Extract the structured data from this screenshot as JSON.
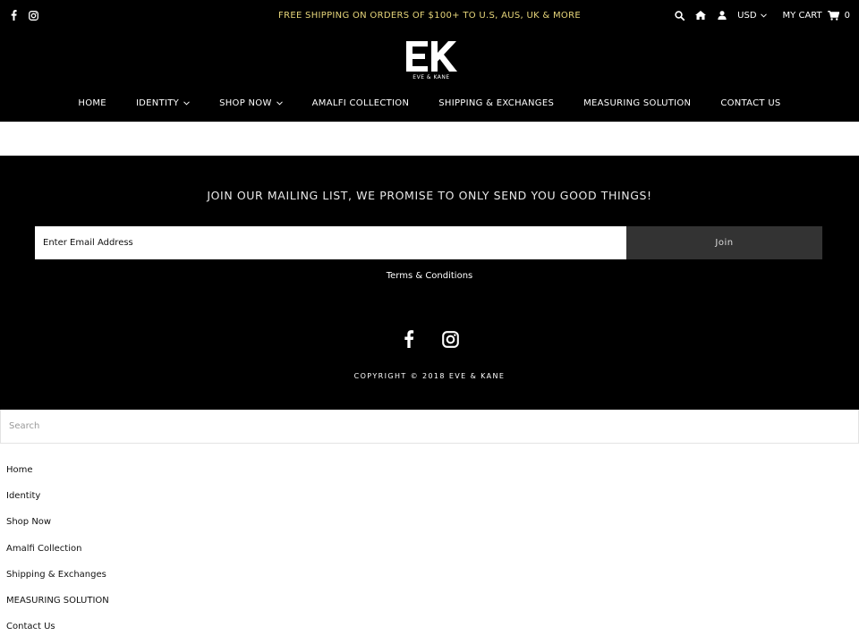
{
  "header": {
    "promo": "FREE SHIPPING ON ORDERS OF $100+ TO U.S, AUS, UK & MORE",
    "currency": "USD",
    "cart_label": "MY CART",
    "cart_count": "0",
    "logo_letters": "EK",
    "logo_text": "EVE & KANE",
    "social_icons": [
      "facebook-icon",
      "instagram-icon"
    ],
    "util_icons": [
      "search-icon",
      "home-icon",
      "user-icon",
      "cart-icon"
    ]
  },
  "nav": {
    "items": [
      {
        "label": "HOME",
        "dropdown": false
      },
      {
        "label": "IDENTITY",
        "dropdown": true
      },
      {
        "label": "SHOP NOW",
        "dropdown": true
      },
      {
        "label": "AMALFI COLLECTION",
        "dropdown": false
      },
      {
        "label": "SHIPPING & EXCHANGES",
        "dropdown": false
      },
      {
        "label": "MEASURING SOLUTION",
        "dropdown": false
      },
      {
        "label": "CONTACT US",
        "dropdown": false
      }
    ]
  },
  "footer": {
    "mailing_heading": "JOIN OUR MAILING LIST, WE PROMISE TO ONLY SEND YOU GOOD THINGS!",
    "email_placeholder": "Enter Email Address",
    "join_label": "Join",
    "terms": "Terms & Conditions",
    "copyright": "COPYRIGHT © 2018 EVE & KANE"
  },
  "mobile_menu": {
    "search_placeholder": "Search",
    "items": [
      "Home",
      "Identity",
      "Shop Now",
      "Amalfi Collection",
      "Shipping & Exchanges",
      "MEASURING SOLUTION",
      "Contact Us"
    ]
  },
  "colors": {
    "header_bg": "#000000",
    "promo_text": "#e6d57a",
    "join_button_bg": "#333333"
  }
}
